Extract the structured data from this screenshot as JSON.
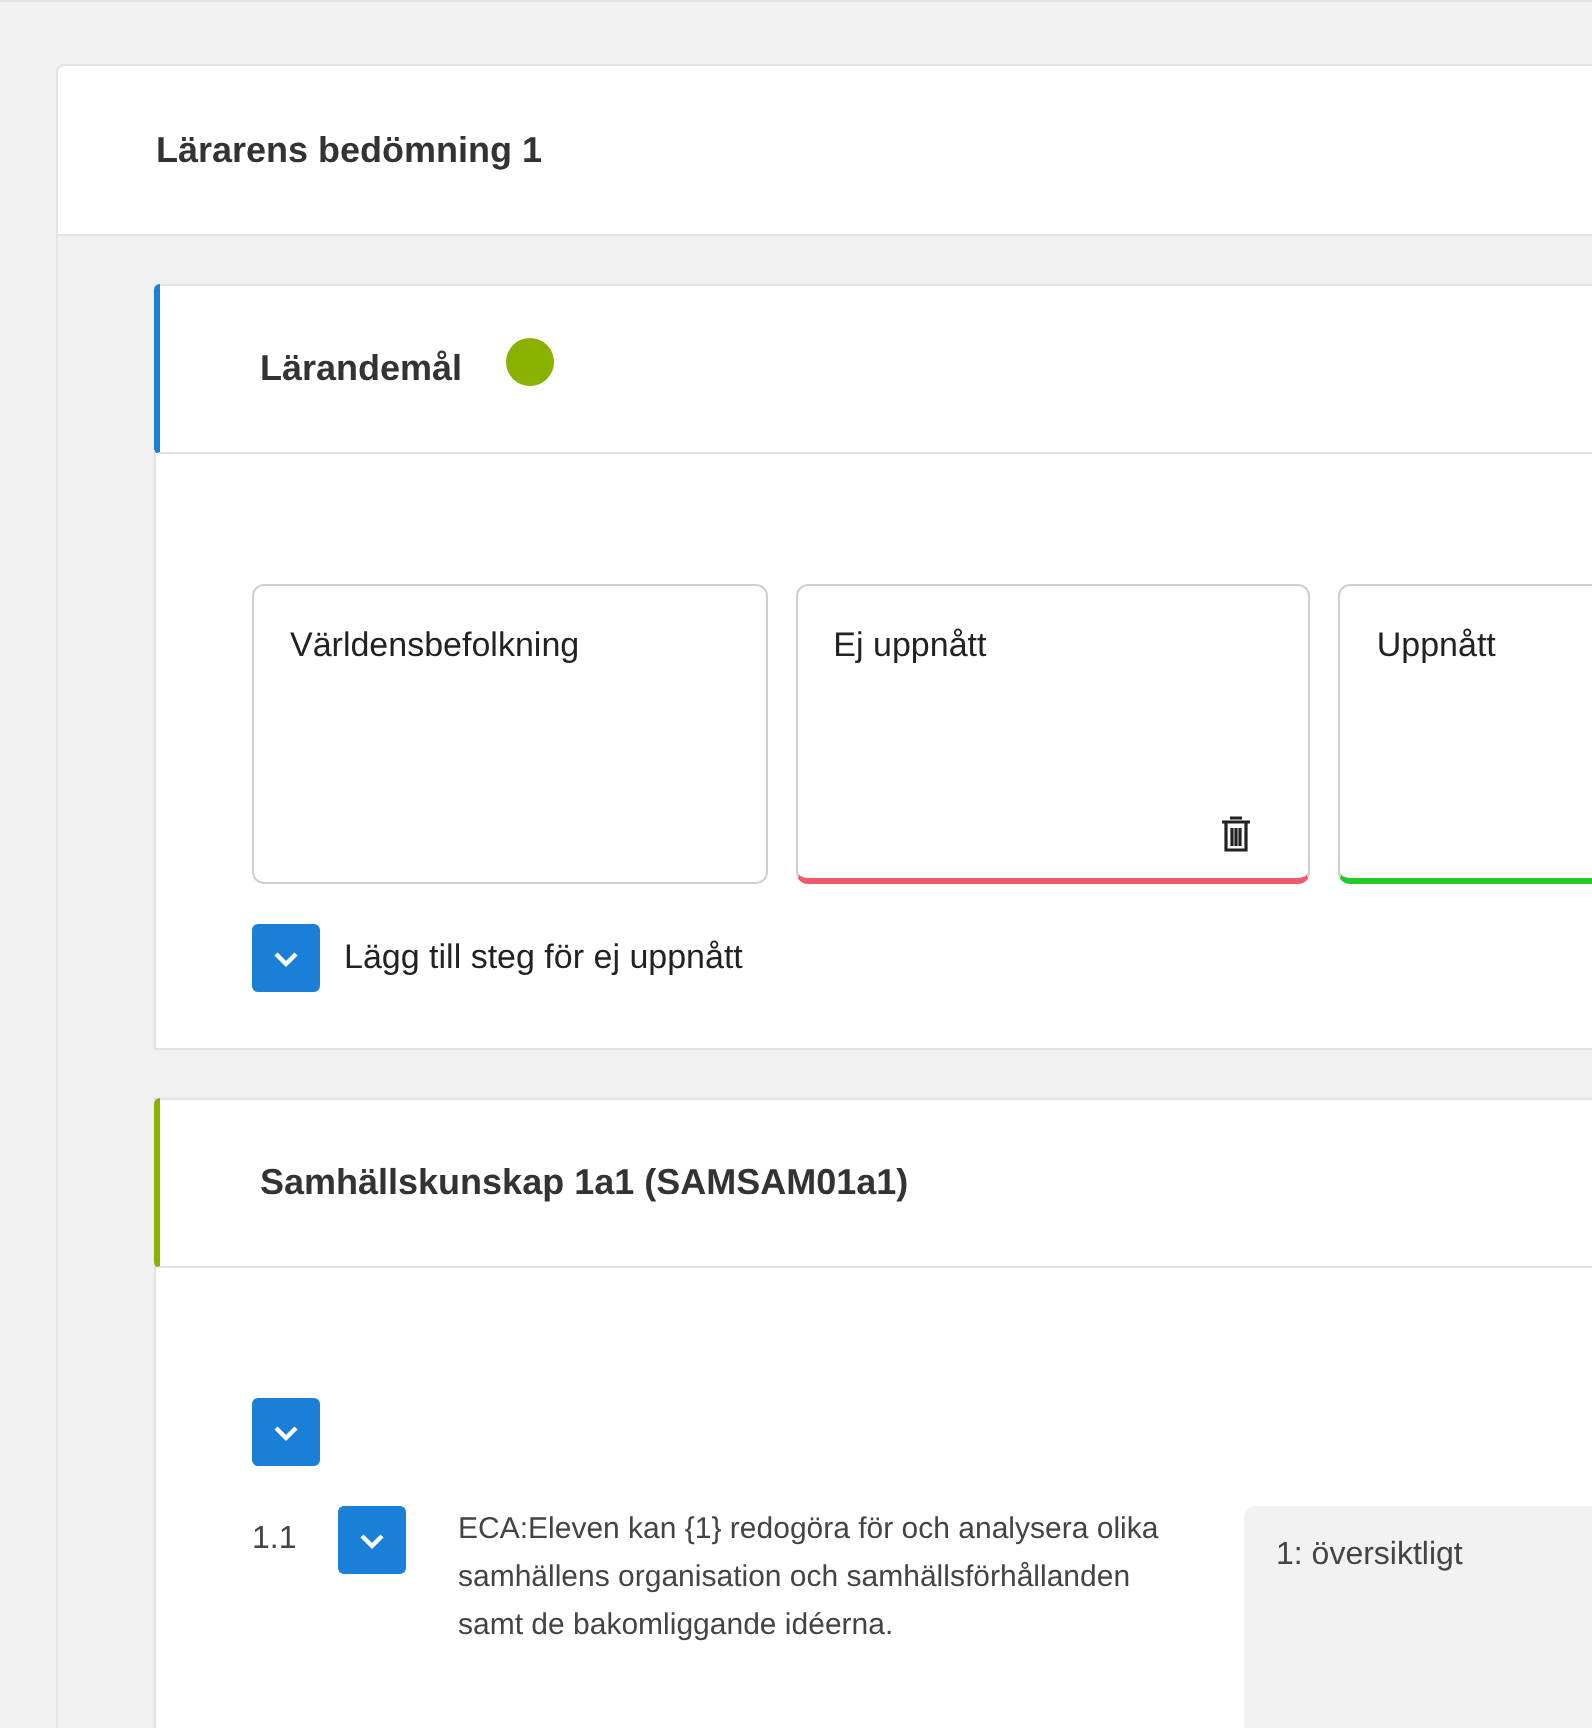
{
  "assessment": {
    "title": "Lärarens bedömning 1"
  },
  "goals": {
    "title": "Lärandemål",
    "color": "#1a7fd6",
    "status_dot": {
      "color": "#8ab000"
    },
    "cards": [
      {
        "text": "Världensbefolkning",
        "deletable": false
      },
      {
        "text": "Ej uppnått",
        "color": "#f0596a",
        "deletable": true
      },
      {
        "text": "Uppnått",
        "color": "#22cc22",
        "deletable": false
      }
    ],
    "option": {
      "label": "Lägg till steg för ej uppnått",
      "checked": true
    }
  },
  "course": {
    "title": "Samhällskunskap 1a1 (SAMSAM01a1)",
    "color": "#8ab000",
    "select_all": {
      "checked": true
    },
    "criteria": [
      {
        "number": "1.1",
        "checked": true,
        "text": "ECA:Eleven kan {1} redogöra för och analysera olika samhällens organisation och samhällsförhållanden samt de bakomliggande idéerna.",
        "level": "1: översiktligt"
      }
    ]
  }
}
